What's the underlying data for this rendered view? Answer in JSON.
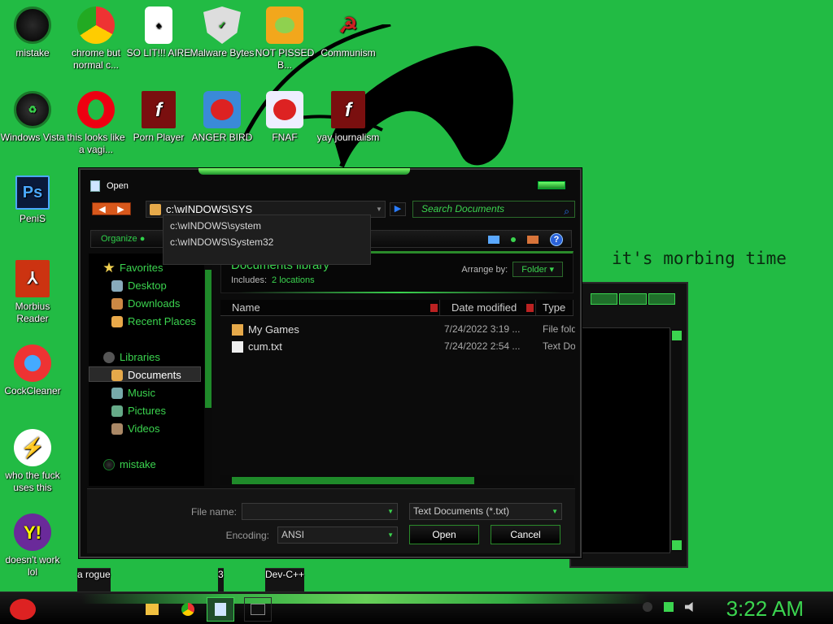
{
  "wallpaper": {
    "caption": "it's morbing time"
  },
  "desktop_icons": [
    {
      "label": "mistake",
      "icon": "green-orb-icon"
    },
    {
      "label": "chrome but normal c...",
      "icon": "chrome-icon"
    },
    {
      "label": "SO LIT!!! AIRE",
      "icon": "solitaire-icon"
    },
    {
      "label": "Malware Bytes",
      "icon": "shield-icon"
    },
    {
      "label": "NOT PISSED B...",
      "icon": "bad-piggies-icon"
    },
    {
      "label": "Communism",
      "icon": "hammer-sickle-icon"
    },
    {
      "label": "Windows Vista",
      "icon": "recycle-bin-icon"
    },
    {
      "label": "this looks like a vagi...",
      "icon": "opera-icon"
    },
    {
      "label": "Porn Player",
      "icon": "flash-icon"
    },
    {
      "label": "ANGER BIRD",
      "icon": "angry-bird-icon"
    },
    {
      "label": "FNAF",
      "icon": "angry-bird-icon"
    },
    {
      "label": "yay journalism",
      "icon": "flash-icon"
    },
    {
      "label": "PeniS",
      "icon": "photoshop-icon"
    },
    {
      "label": "Morbius Reader",
      "icon": "pdf-icon"
    },
    {
      "label": "CockCleaner",
      "icon": "ccleaner-icon"
    },
    {
      "label": "who the fuck uses this",
      "icon": "lightning-icon"
    },
    {
      "label": "doesn't work lol",
      "icon": "yahoo-icon"
    },
    {
      "label": "a rogue",
      "icon": "generic-icon"
    },
    {
      "label": "3",
      "icon": "generic-icon"
    },
    {
      "label": "Dev-C++",
      "icon": "generic-icon"
    }
  ],
  "dialog": {
    "title": "Open",
    "address_value": "c:\\wINDOWS\\SYS",
    "search_placeholder": "Search Documents",
    "autocomplete": [
      "c:\\wINDOWS\\system",
      "c:\\wINDOWS\\System32"
    ],
    "organize_label": "Organize",
    "nav": {
      "favorites": "Favorites",
      "desktop": "Desktop",
      "downloads": "Downloads",
      "recent": "Recent Places",
      "libraries": "Libraries",
      "documents": "Documents",
      "music": "Music",
      "pictures": "Pictures",
      "videos": "Videos",
      "homegroup": "mistake"
    },
    "library": {
      "title": "Documents library",
      "includes_label": "Includes:",
      "includes_value": "2 locations",
      "arrange_label": "Arrange by:",
      "arrange_value": "Folder"
    },
    "columns": {
      "name": "Name",
      "date": "Date modified",
      "type": "Type"
    },
    "files": [
      {
        "name": "My Games",
        "date": "7/24/2022 3:19 ...",
        "type": "File folder",
        "icon": "folder-icon"
      },
      {
        "name": "cum.txt",
        "date": "7/24/2022 2:54 ...",
        "type": "Text Document",
        "icon": "text-file-icon"
      }
    ],
    "file_name_label": "File name:",
    "file_name_value": "",
    "filter_value": "Text Documents (*.txt)",
    "encoding_label": "Encoding:",
    "encoding_value": "ANSI",
    "open_label": "Open",
    "cancel_label": "Cancel"
  },
  "taskbar": {
    "clock": "3:22 AM"
  }
}
